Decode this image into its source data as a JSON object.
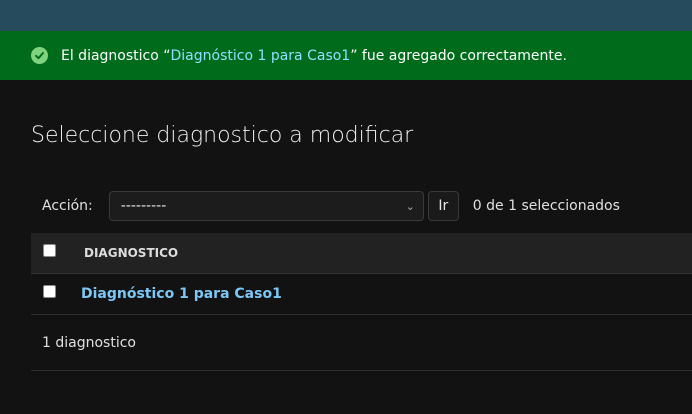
{
  "message": {
    "prefix": "El diagnostico “",
    "link": "Diagnóstico 1 para Caso1",
    "suffix": "” fue agregado correctamente."
  },
  "page_title": "Seleccione diagnostico a modificar",
  "actions": {
    "label": "Acción:",
    "selected": "---------",
    "go_label": "Ir",
    "counter": "0 de 1 seleccionados"
  },
  "table": {
    "header": "DIAGNOSTICO",
    "rows": [
      {
        "label": "Diagnóstico 1 para Caso1"
      }
    ]
  },
  "paginator": "1 diagnostico",
  "colors": {
    "success_bg": "#006b1b",
    "link": "#7cc7f5",
    "topbar": "#264b5d"
  }
}
